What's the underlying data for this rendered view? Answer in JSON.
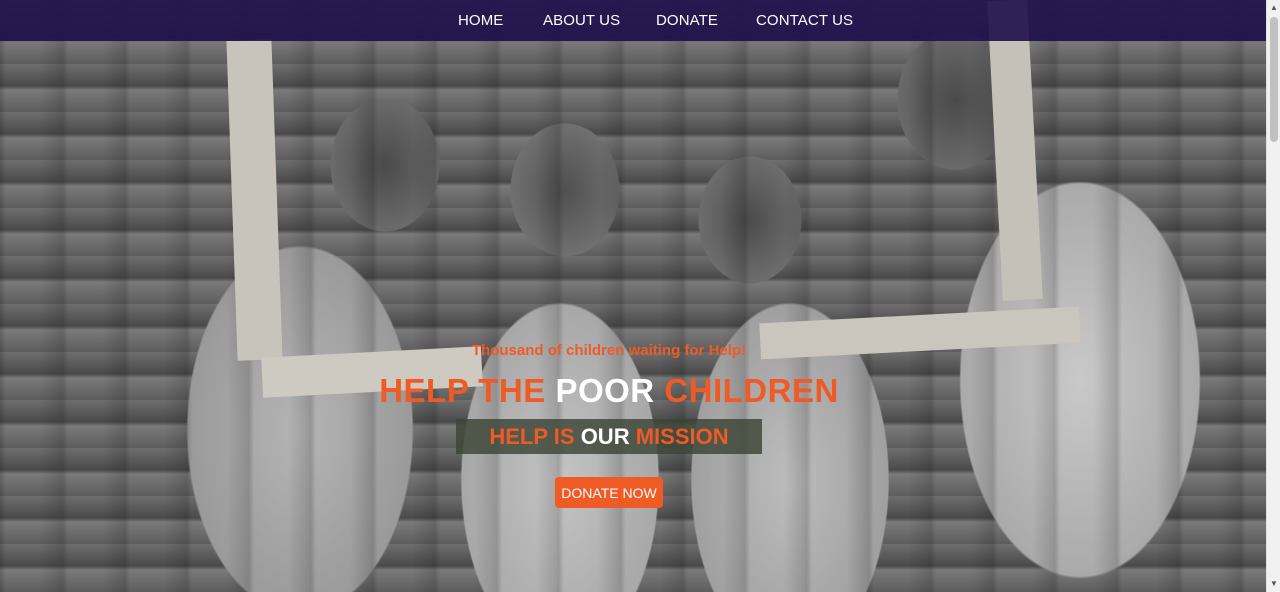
{
  "nav": {
    "items": [
      {
        "label": "HOME"
      },
      {
        "label": "ABOUT US"
      },
      {
        "label": "DONATE"
      },
      {
        "label": "CONTACT US"
      }
    ]
  },
  "hero": {
    "tagline": "Thousand of children waiting for Help!",
    "headline": {
      "part1": "HELP THE",
      "part2": "POOR",
      "part3": "CHILDREN"
    },
    "mission": {
      "part1": "HELP IS",
      "part2": "OUR",
      "part3": "MISSION"
    },
    "button_label": "DONATE NOW"
  },
  "colors": {
    "nav_background": "#22124d",
    "accent": "#f05a24",
    "mission_background": "#3c4637"
  },
  "icons": {
    "scroll_up": "triangle-up-icon",
    "scroll_down": "triangle-down-icon"
  }
}
